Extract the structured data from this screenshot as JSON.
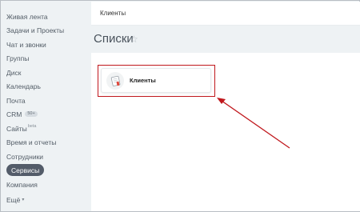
{
  "sidebar": {
    "items": [
      {
        "label": "Живая лента"
      },
      {
        "label": "Задачи и Проекты"
      },
      {
        "label": "Чат и звонки"
      },
      {
        "label": "Группы"
      },
      {
        "label": "Диск"
      },
      {
        "label": "Календарь"
      },
      {
        "label": "Почта"
      },
      {
        "label": "CRM",
        "badge": "50+"
      },
      {
        "label": "Сайты",
        "sup": "beta"
      },
      {
        "label": "Время и отчеты"
      },
      {
        "label": "Сотрудники"
      },
      {
        "label": "Сервисы",
        "active": true
      },
      {
        "label": "Компания"
      },
      {
        "label": "Ещё",
        "caret": "▾"
      }
    ]
  },
  "header": {
    "title": "Клиенты"
  },
  "page": {
    "title": "Списки",
    "star": "☆"
  },
  "card": {
    "label": "Клиенты",
    "icon": "list-icon"
  },
  "colors": {
    "highlight": "#c0171c",
    "sidebar_bg": "#eef2f4",
    "active_bg": "#535c69"
  }
}
